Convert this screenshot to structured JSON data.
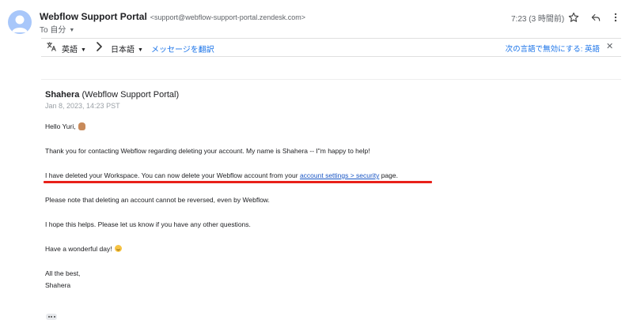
{
  "header": {
    "sender_name": "Webflow Support Portal",
    "sender_email": "<support@webflow-support-portal.zendesk.com>",
    "to_line": "To 自分",
    "time": "7:23 (3 時間前)"
  },
  "translate_bar": {
    "from_language": "英語",
    "to_language": "日本語",
    "translate_link": "メッセージを翻訳",
    "disable_link": "次の言語で無効にする: 英語"
  },
  "message": {
    "author_name": "Shahera",
    "author_org": " (Webflow Support Portal)",
    "date": "Jan 8, 2023, 14:23 PST",
    "greeting": "Hello Yuri,",
    "para1": "Thank you for contacting Webflow regarding deleting your account. My name is Shahera -- I\"m happy to help!",
    "para2_before": "I have deleted your Workspace. You can now delete your Webflow account from your ",
    "para2_link": "account settings > security",
    "para2_after": " page.",
    "para3": "Please note that deleting an account cannot be reversed, even by Webflow.",
    "para4": "I hope this helps. Please let us know if you have any other questions.",
    "para5": "Have a wonderful day!",
    "signoff": "All the best,",
    "signature": "Shahera"
  },
  "colors": {
    "link": "#1a73e8",
    "highlight_underline": "#e8201a",
    "avatar": "#a8c7fa"
  },
  "icons": [
    "person-avatar-icon",
    "star-icon",
    "reply-icon",
    "more-vert-icon",
    "translate-icon",
    "chevron-right-icon",
    "close-icon",
    "waving-hand-emoji",
    "smiling-face-emoji"
  ]
}
